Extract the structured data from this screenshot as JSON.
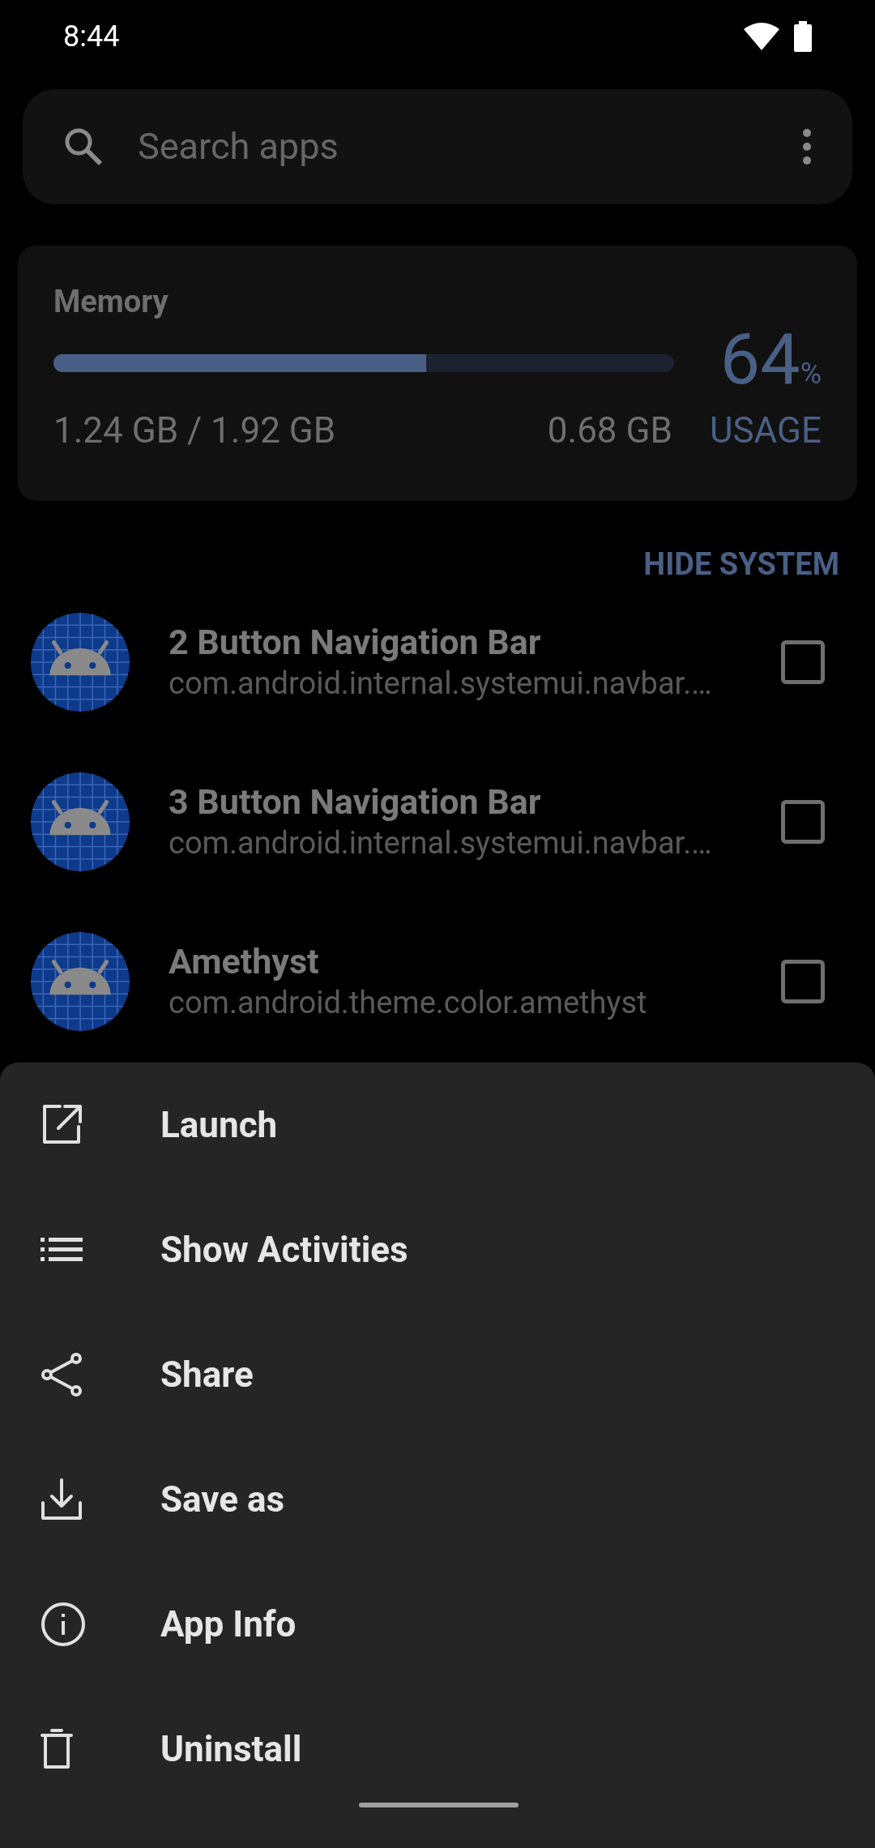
{
  "status_bar": {
    "time": "8:44"
  },
  "search": {
    "placeholder": "Search apps"
  },
  "memory": {
    "label": "Memory",
    "level": 0.6,
    "percent": "64",
    "percent_sign": "%",
    "used": "1.24 GB / 1.92 GB",
    "free": "0.68 GB",
    "action": "USAGE"
  },
  "filter_button": "HIDE SYSTEM",
  "apps": [
    {
      "name": "2 Button Navigation Bar",
      "package": "com.android.internal.systemui.navbar.…",
      "checked": false
    },
    {
      "name": "3 Button Navigation Bar",
      "package": "com.android.internal.systemui.navbar.…",
      "checked": false
    },
    {
      "name": "Amethyst",
      "package": "com.android.theme.color.amethyst",
      "checked": false
    }
  ],
  "menu": [
    {
      "kind": "launch",
      "label": "Launch"
    },
    {
      "kind": "list",
      "label": "Show Activities"
    },
    {
      "kind": "share",
      "label": "Share"
    },
    {
      "kind": "download",
      "label": "Save as"
    },
    {
      "kind": "info",
      "label": "App Info"
    },
    {
      "kind": "trash",
      "label": "Uninstall"
    }
  ]
}
